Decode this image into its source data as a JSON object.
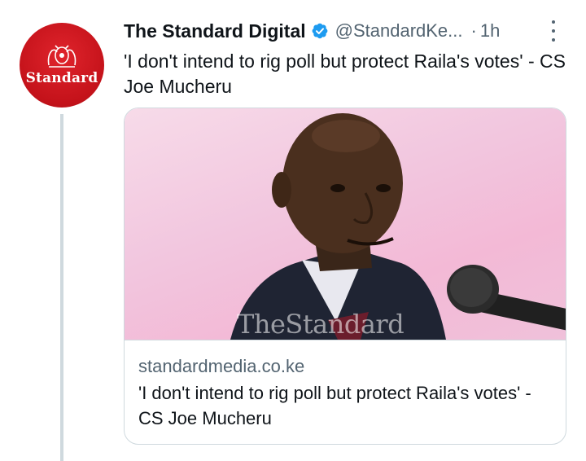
{
  "author": {
    "name": "The Standard Digital",
    "handle": "@StandardKe...",
    "separator": "·",
    "time": "1h",
    "avatar_text": "Standard",
    "verified": true
  },
  "tweet": {
    "text": "'I don't intend to rig poll but protect Raila's votes' - CS Joe Mucheru"
  },
  "card": {
    "domain": "standardmedia.co.ke",
    "title": "'I don't intend to rig poll but protect Raila's votes' - CS Joe Mucheru",
    "image_watermark": "TheStandard"
  },
  "colors": {
    "brand_red": "#c4121a",
    "verified_blue": "#1d9bf0",
    "secondary_text": "#536471",
    "border": "#cfd9de"
  },
  "icons": {
    "verified": "verified-badge-icon",
    "more": "more-options-icon"
  }
}
